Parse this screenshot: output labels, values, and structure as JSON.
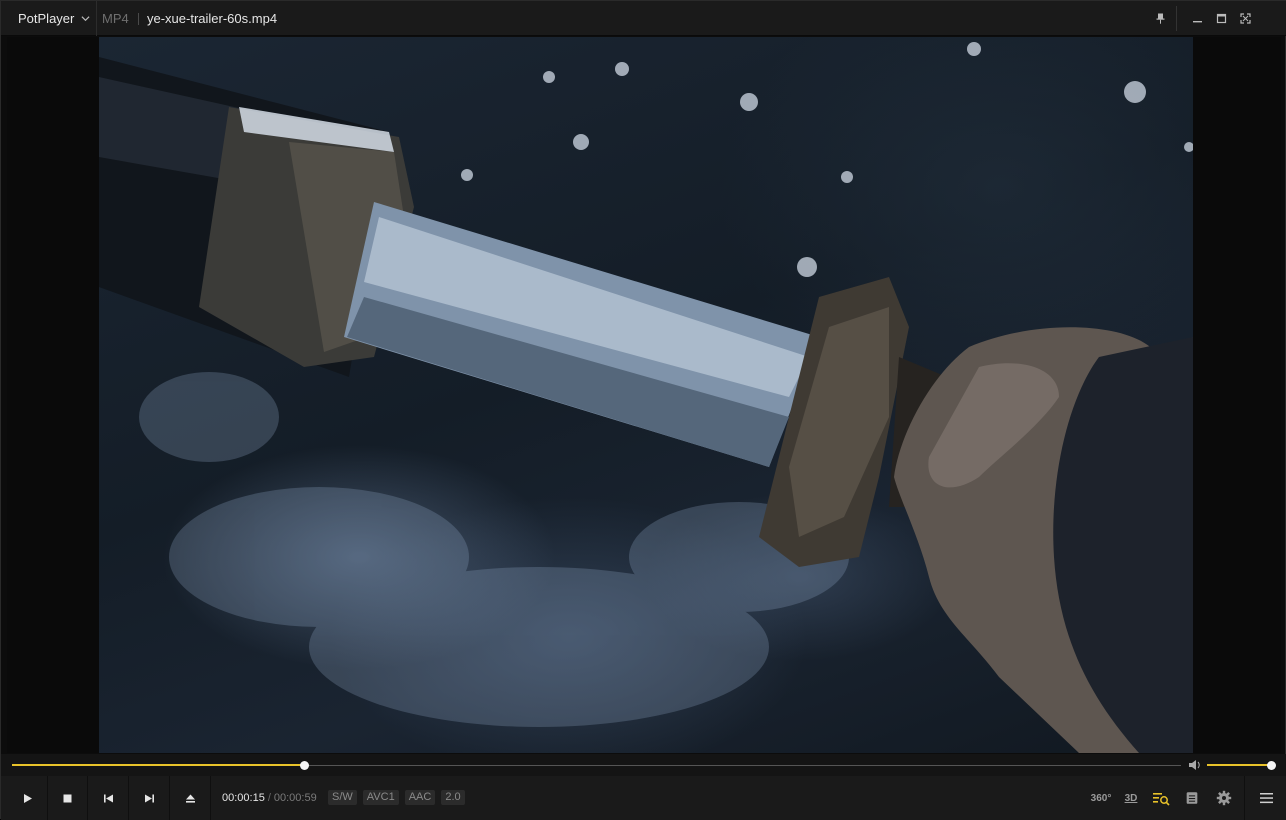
{
  "app": {
    "brand": "PotPlayer",
    "format": "MP4",
    "filename": "ye-xue-trailer-60s.mp4"
  },
  "window_buttons": [
    "pin-icon",
    "minimize-icon",
    "maximize-icon",
    "fullscreen-icon"
  ],
  "playback": {
    "current_time": "00:00:15",
    "separator": "/",
    "duration": "00:00:59",
    "progress_fraction": 0.25,
    "volume_fraction": 1.0
  },
  "media_tags": [
    "S/W",
    "AVC1",
    "AAC",
    "2.0"
  ],
  "right_controls": {
    "vr_label": "360°",
    "three_d_label": "3D"
  },
  "colors": {
    "accent": "#e8c22a",
    "background": "#1a1a1a",
    "video_bg": "#141d27"
  }
}
